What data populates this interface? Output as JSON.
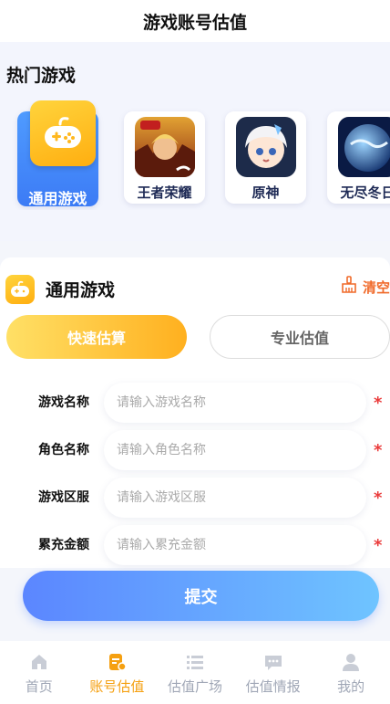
{
  "header": {
    "title": "游戏账号估值"
  },
  "hot_games": {
    "title": "热门游戏",
    "items": [
      {
        "label": "通用游戏",
        "icon": "gamepad-icon",
        "selected": true
      },
      {
        "label": "王者荣耀",
        "icon": "honor-of-kings-icon",
        "selected": false
      },
      {
        "label": "原神",
        "icon": "genshin-icon",
        "selected": false
      },
      {
        "label": "无尽冬日",
        "icon": "whiteout-survival-icon",
        "selected": false
      }
    ]
  },
  "form": {
    "title": "通用游戏",
    "clear_label": "清空",
    "tabs": {
      "quick": "快速估算",
      "pro": "专业估值"
    },
    "fields": [
      {
        "label": "游戏名称",
        "placeholder": "请输入游戏名称",
        "required_mark": "*"
      },
      {
        "label": "角色名称",
        "placeholder": "请输入角色名称",
        "required_mark": "*"
      },
      {
        "label": "游戏区服",
        "placeholder": "请输入游戏区服",
        "required_mark": "*"
      },
      {
        "label": "累充金额",
        "placeholder": "请输入累充金额",
        "required_mark": "*"
      }
    ],
    "submit_label": "提交"
  },
  "tabbar": {
    "items": [
      {
        "label": "首页",
        "icon": "home-icon",
        "active": false
      },
      {
        "label": "账号估值",
        "icon": "valuation-icon",
        "active": true
      },
      {
        "label": "估值广场",
        "icon": "list-icon",
        "active": false
      },
      {
        "label": "估值情报",
        "icon": "chat-icon",
        "active": false
      },
      {
        "label": "我的",
        "icon": "user-icon",
        "active": false
      }
    ]
  },
  "colors": {
    "accent": "#f5a011",
    "primary_blue": "#3c7bf5",
    "required": "#ea3b3b",
    "clear": "#f06a2a"
  }
}
